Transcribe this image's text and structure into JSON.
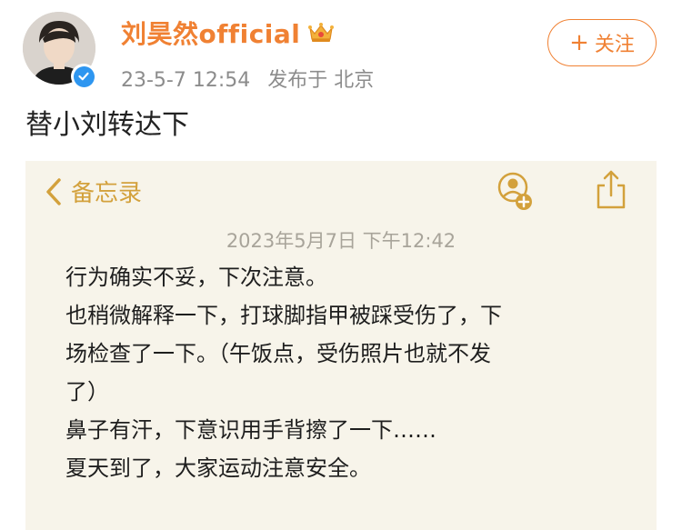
{
  "author": {
    "name": "刘昊然official",
    "verified": true,
    "badge": "crown-icon"
  },
  "post_meta": {
    "datetime": "23-5-7 12:54",
    "location": "发布于 北京"
  },
  "follow_button": {
    "plus": "+",
    "label": "关注"
  },
  "post_text": "替小刘转达下",
  "memo": {
    "back_label": "备忘录",
    "date": "2023年5月7日 下午12:42",
    "lines": [
      "行为确实不妥，下次注意。",
      "也稍微解释一下，打球脚指甲被踩受伤了，下",
      "场检查了一下。（午饭点，受伤照片也就不发",
      "了）",
      "鼻子有汗，下意识用手背擦了一下……",
      "夏天到了，大家运动注意安全。"
    ]
  },
  "colors": {
    "accent": "#f08133",
    "memo_gold": "#d3a13c",
    "memo_bg": "#f7f4ea",
    "verified_blue": "#2e96f0"
  }
}
